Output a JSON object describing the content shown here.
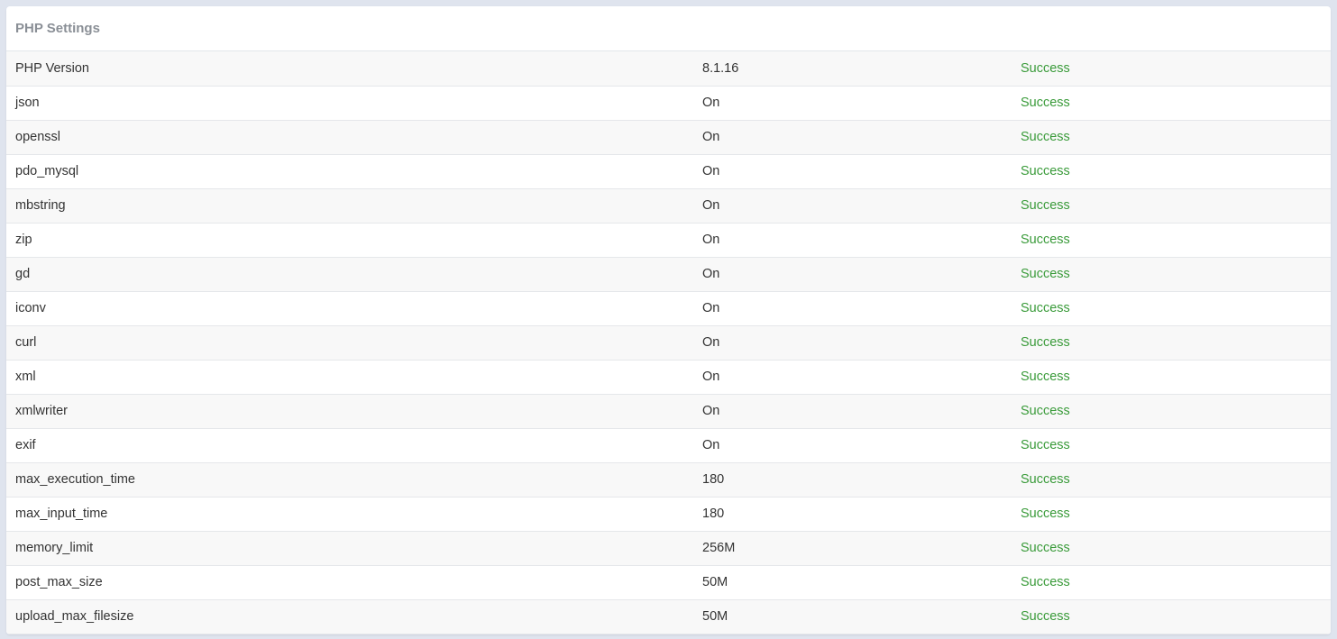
{
  "card": {
    "title": "PHP Settings"
  },
  "rows": [
    {
      "name": "PHP Version",
      "value": "8.1.16",
      "status": "Success"
    },
    {
      "name": "json",
      "value": "On",
      "status": "Success"
    },
    {
      "name": "openssl",
      "value": "On",
      "status": "Success"
    },
    {
      "name": "pdo_mysql",
      "value": "On",
      "status": "Success"
    },
    {
      "name": "mbstring",
      "value": "On",
      "status": "Success"
    },
    {
      "name": "zip",
      "value": "On",
      "status": "Success"
    },
    {
      "name": "gd",
      "value": "On",
      "status": "Success"
    },
    {
      "name": "iconv",
      "value": "On",
      "status": "Success"
    },
    {
      "name": "curl",
      "value": "On",
      "status": "Success"
    },
    {
      "name": "xml",
      "value": "On",
      "status": "Success"
    },
    {
      "name": "xmlwriter",
      "value": "On",
      "status": "Success"
    },
    {
      "name": "exif",
      "value": "On",
      "status": "Success"
    },
    {
      "name": "max_execution_time",
      "value": "180",
      "status": "Success"
    },
    {
      "name": "max_input_time",
      "value": "180",
      "status": "Success"
    },
    {
      "name": "memory_limit",
      "value": "256M",
      "status": "Success"
    },
    {
      "name": "post_max_size",
      "value": "50M",
      "status": "Success"
    },
    {
      "name": "upload_max_filesize",
      "value": "50M",
      "status": "Success"
    }
  ],
  "colors": {
    "page_background": "#dfe4ee",
    "card_background": "#ffffff",
    "row_stripe": "#f8f8f8",
    "title": "#8a8f96",
    "text": "#333333",
    "success": "#3a9b3a"
  }
}
